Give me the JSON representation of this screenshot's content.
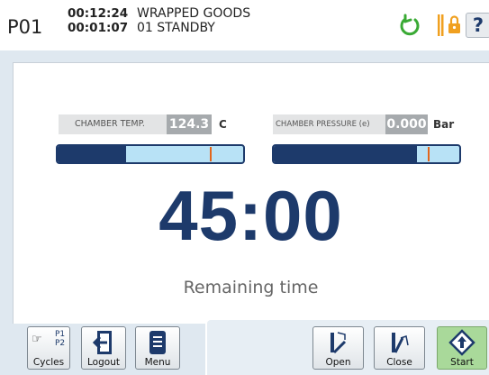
{
  "header": {
    "program": "P01",
    "elapsed_time": "00:12:24",
    "phase_time": "00:01:07",
    "cycle_name": "WRAPPED GOODS",
    "status": "01 STANDBY"
  },
  "icons": {
    "power": "power-icon",
    "lock": "lock-icon",
    "help": "?"
  },
  "sensors": {
    "chamber_temp": {
      "label": "CHAMBER TEMP.",
      "value": "124.3",
      "unit": "C",
      "level": 0.37,
      "marker": 0.82
    },
    "chamber_pressure": {
      "label": "CHAMBER PRESSURE (e)",
      "value": "0.000",
      "unit": "Bar",
      "level": 0.77,
      "marker": 0.83
    }
  },
  "timer": {
    "value": "45:00",
    "label": "Remaining time"
  },
  "buttons": {
    "cycles": "Cycles",
    "cycles_p1": "P1",
    "cycles_p2": "P2",
    "logout": "Logout",
    "menu": "Menu",
    "open": "Open",
    "close": "Close",
    "start": "Start"
  },
  "colors": {
    "navy": "#1d3a6b",
    "bar_light": "#b8e2f6",
    "marker": "#e2661c",
    "power_green": "#3aaa35",
    "lock_orange": "#f0a020",
    "start_green": "#a9d99a"
  }
}
